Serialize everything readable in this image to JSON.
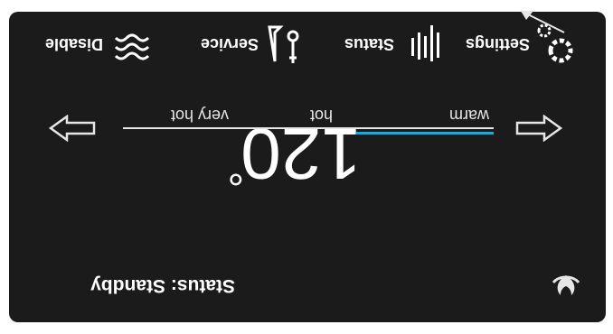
{
  "status": {
    "text": "Status: Standby"
  },
  "temperature": {
    "value": "120",
    "unit": "°"
  },
  "scale": {
    "labels": {
      "warm": "warm",
      "hot": "hot",
      "very_hot": "very hot"
    },
    "active_color": "#24a8d0",
    "level": "warm"
  },
  "menu": {
    "settings": "Settings",
    "status": "Status",
    "service": "Service",
    "disable": "Disable"
  },
  "icons": {
    "flame": "flame-icon",
    "arrow_left": "arrow-left-icon",
    "arrow_right": "arrow-right-icon",
    "gear": "gear-icon",
    "status_bars": "status-bars-icon",
    "service_tools": "tools-icon",
    "disable_waves": "waves-icon"
  },
  "orientation": "rotated-180"
}
